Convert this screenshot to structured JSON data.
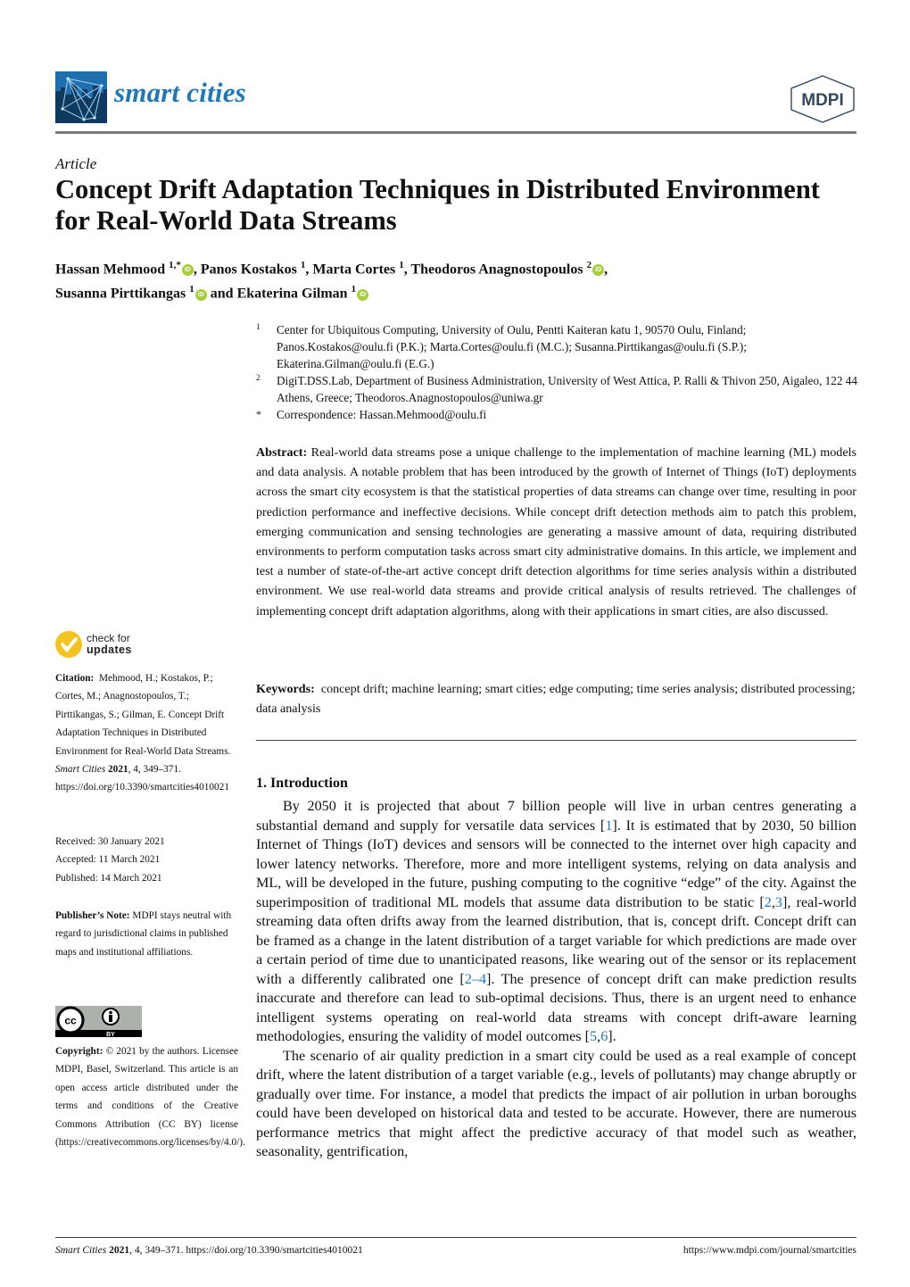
{
  "header": {
    "journal_name": "smart cities",
    "publisher": "MDPI",
    "logo_icon": "smart-cities-logo-icon",
    "publisher_icon": "mdpi-hexagon-logo-icon"
  },
  "article": {
    "type": "Article",
    "title": "Concept Drift Adaptation Techniques in Distributed Environment for Real-World Data Streams",
    "authors": [
      {
        "name": "Hassan Mehmood",
        "sup": "1,*",
        "orcid": true,
        "sep": ", "
      },
      {
        "name": "Panos Kostakos",
        "sup": "1",
        "orcid": false,
        "sep": ", "
      },
      {
        "name": "Marta Cortes",
        "sup": "1",
        "orcid": false,
        "sep": ", "
      },
      {
        "name": "Theodoros Anagnostopoulos",
        "sup": "2",
        "orcid": true,
        "sep": ","
      },
      {
        "name": "Susanna Pirttikangas",
        "sup": "1",
        "orcid": true,
        "sep": " and "
      },
      {
        "name": "Ekaterina Gilman",
        "sup": "1",
        "orcid": true,
        "sep": ""
      }
    ],
    "affiliations": [
      {
        "mark": "1",
        "text": "Center for Ubiquitous Computing, University of Oulu, Pentti Kaiteran katu 1, 90570 Oulu, Finland; Panos.Kostakos@oulu.fi (P.K.); Marta.Cortes@oulu.fi (M.C.); Susanna.Pirttikangas@oulu.fi (S.P.); Ekaterina.Gilman@oulu.fi (E.G.)"
      },
      {
        "mark": "2",
        "text": "DigiT.DSS.Lab, Department of Business Administration, University of West Attica, P. Ralli & Thivon 250, Aigaleo, 122 44 Athens, Greece; Theodoros.Anagnostopoulos@uniwa.gr"
      },
      {
        "mark": "*",
        "text": "Correspondence: Hassan.Mehmood@oulu.fi"
      }
    ]
  },
  "sidebar": {
    "check_updates": {
      "line1": "check for",
      "line2": "updates"
    },
    "citation": {
      "label": "Citation:",
      "text": "Mehmood, H.; Kostakos, P.; Cortes, M.; Anagnostopoulos, T.; Pirttikangas, S.; Gilman, E. Concept Drift Adaptation Techniques in Distributed Environment for Real-World Data Streams.",
      "journal": "Smart Cities",
      "year": "2021",
      "rest": ", 4, 349–371. https://doi.org/10.3390/smartcities4010021"
    },
    "dates": {
      "received": "Received: 30 January 2021",
      "accepted": "Accepted: 11 March 2021",
      "published": "Published: 14 March 2021"
    },
    "publisher_note": {
      "label": "Publisher’s Note:",
      "text": "MDPI stays neutral with regard to jurisdictional claims in published maps and institutional affiliations."
    },
    "license_badge": {
      "cc": "cc",
      "by": "BY"
    },
    "copyright": {
      "label": "Copyright:",
      "text": "© 2021 by the authors. Licensee MDPI, Basel, Switzerland. This article is an open access article distributed under the terms and conditions of the Creative Commons Attribution (CC BY) license (https://creativecommons.org/licenses/by/4.0/)."
    }
  },
  "abstract": {
    "label": "Abstract:",
    "text": "Real-world data streams pose a unique challenge to the implementation of machine learning (ML) models and data analysis. A notable problem that has been introduced by the growth of Internet of Things (IoT) deployments across the smart city ecosystem is that the statistical properties of data streams can change over time, resulting in poor prediction performance and ineffective decisions. While concept drift detection methods aim to patch this problem, emerging communication and sensing technologies are generating a massive amount of data, requiring distributed environments to perform computation tasks across smart city administrative domains. In this article, we implement and test a number of state-of-the-art active concept drift detection algorithms for time series analysis within a distributed environment. We use real-world data streams and provide critical analysis of results retrieved. The challenges of implementing concept drift adaptation algorithms, along with their applications in smart cities, are also discussed."
  },
  "keywords": {
    "label": "Keywords:",
    "text": "concept drift; machine learning; smart cities; edge computing; time series analysis; distributed processing; data analysis"
  },
  "introduction": {
    "heading": "1. Introduction",
    "p1": [
      {
        "t": "By 2050 it is projected that about 7 billion people will live in urban centres generating a substantial demand and supply for versatile data services ["
      },
      {
        "ref": "1"
      },
      {
        "t": "]. It is estimated that by 2030, 50 billion Internet of Things (IoT) devices and sensors will be connected to the internet over high capacity and lower latency networks. Therefore, more and more intelligent systems, relying on data analysis and ML, will be developed in the future, pushing computing to the cognitive “edge” of the city. Against the superimposition of traditional ML models that assume data distribution to be static ["
      },
      {
        "ref": "2"
      },
      {
        "t": ","
      },
      {
        "ref": "3"
      },
      {
        "t": "], real-world streaming data often drifts away from the learned distribution, that is, concept drift. Concept drift can be framed as a change in the latent distribution of a target variable for which predictions are made over a certain period of time due to unanticipated reasons, like wearing out of the sensor or its replacement with a differently calibrated one ["
      },
      {
        "ref": "2–4"
      },
      {
        "t": "]. The presence of concept drift can make prediction results inaccurate and therefore can lead to sub-optimal decisions. Thus, there is an urgent need to enhance intelligent systems operating on real-world data streams with concept drift-aware learning methodologies, ensuring the validity of model outcomes ["
      },
      {
        "ref": "5"
      },
      {
        "t": ","
      },
      {
        "ref": "6"
      },
      {
        "t": "]."
      }
    ],
    "p2": "The scenario of air quality prediction in a smart city could be used as a real example of concept drift, where the latent distribution of a target variable (e.g., levels of pollutants) may change abruptly or gradually over time. For instance, a model that predicts the impact of air pollution in urban boroughs could have been developed on historical data and tested to be accurate. However, there are numerous performance metrics that might affect the predictive accuracy of that model such as weather, seasonality, gentrification,"
  },
  "footer": {
    "journal": "Smart Cities",
    "year": "2021",
    "rest": ", 4, 349–371. https://doi.org/10.3390/smartcities4010021",
    "url": "https://www.mdpi.com/journal/smartcities"
  },
  "colors": {
    "brand_blue": "#1f78b8",
    "orcid_green": "#a6ce39",
    "check_yellow": "#f4c320"
  }
}
